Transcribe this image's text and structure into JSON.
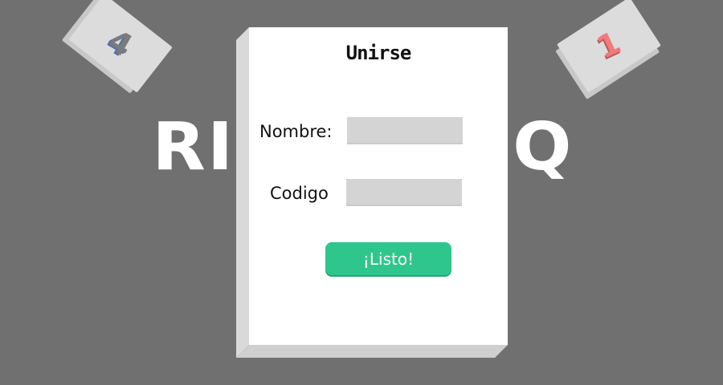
{
  "background": {
    "logo_left": "RI",
    "logo_right": "Q"
  },
  "cards": {
    "left_value": "4",
    "right_value": "1"
  },
  "dialog": {
    "title": "Unirse",
    "name_label": "Nombre:",
    "name_value": "",
    "code_label": "Codigo",
    "code_value": "",
    "submit_label": "¡Listo!"
  },
  "colors": {
    "background": "#707070",
    "panel": "#ffffff",
    "input": "#d4d4d4",
    "button": "#2fc68d",
    "card_left_accent": "#4f6fb5",
    "card_right_accent": "#f07b7b"
  }
}
